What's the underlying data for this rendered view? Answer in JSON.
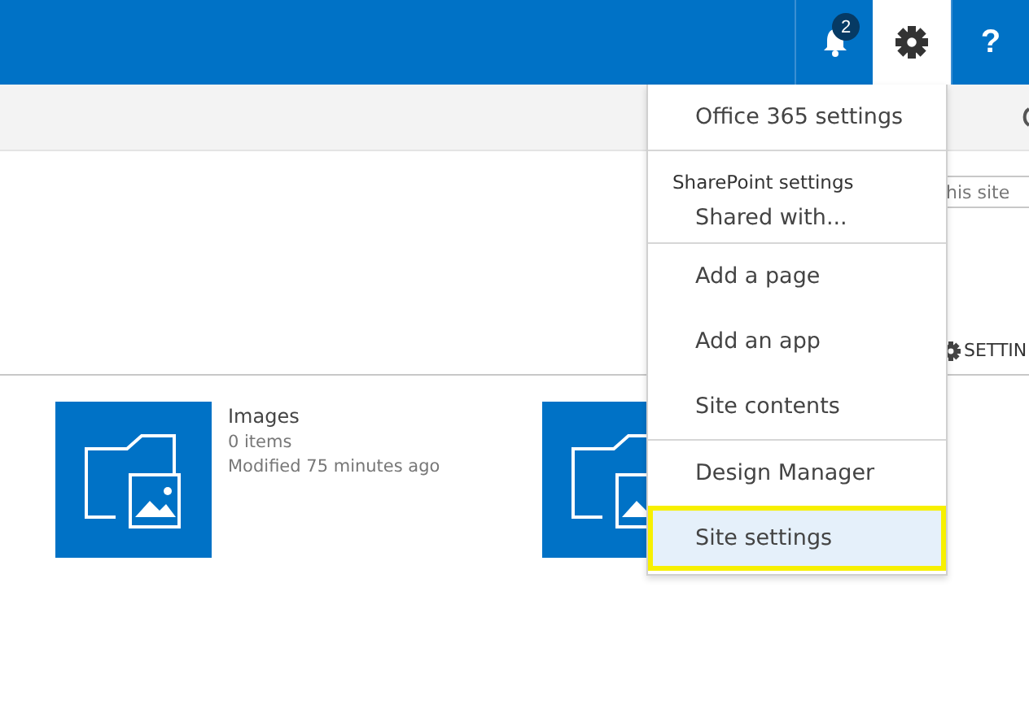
{
  "top_bar": {
    "notification_count": "2",
    "help": "?"
  },
  "search": {
    "placeholder": "his site"
  },
  "settings_link": "SETTIN",
  "tiles": [
    {
      "kind": "image_library",
      "title": "Images",
      "count": "0 items",
      "modified": "Modified 75 minutes ago"
    },
    {
      "kind": "image_library"
    }
  ],
  "settings_menu": [
    {
      "kind": "item",
      "label": "Office 365 settings",
      "selected": false
    },
    {
      "kind": "divider"
    },
    {
      "kind": "header",
      "label": "SharePoint settings"
    },
    {
      "kind": "item",
      "label": "Shared with...",
      "selected": false
    },
    {
      "kind": "divider"
    },
    {
      "kind": "item",
      "label": "Add a page",
      "selected": false
    },
    {
      "kind": "item",
      "label": "Add an app",
      "selected": false
    },
    {
      "kind": "item",
      "label": "Site contents",
      "selected": false
    },
    {
      "kind": "divider"
    },
    {
      "kind": "item",
      "label": "Design Manager",
      "selected": false
    },
    {
      "kind": "item",
      "label": "Site settings",
      "selected": true
    }
  ]
}
